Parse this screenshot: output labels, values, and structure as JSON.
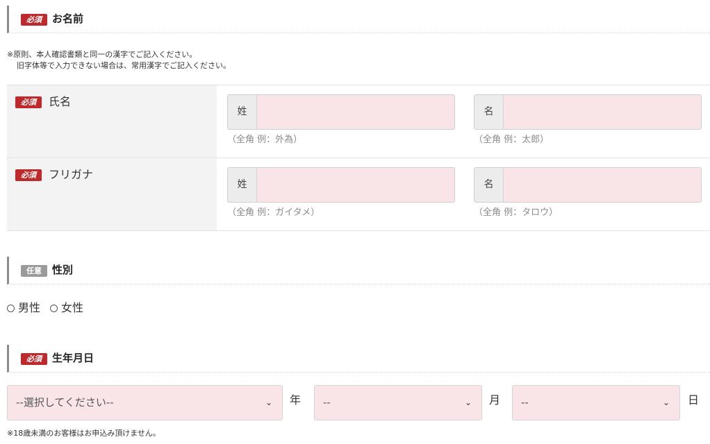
{
  "badges": {
    "required": "必須",
    "optional": "任意"
  },
  "name_section": {
    "title": "お名前",
    "note_line1": "※原則、本人確認書類と同一の漢字でご記入ください。",
    "note_line2": "旧字体等で入力できない場合は、常用漢字でご記入ください。",
    "rows": [
      {
        "label": "氏名",
        "last": {
          "prefix": "姓",
          "value": "",
          "hint": "（全角 例：外為）"
        },
        "first": {
          "prefix": "名",
          "value": "",
          "hint": "（全角 例：太郎）"
        }
      },
      {
        "label": "フリガナ",
        "last": {
          "prefix": "姓",
          "value": "",
          "hint": "（全角 例：ガイタメ）"
        },
        "first": {
          "prefix": "名",
          "value": "",
          "hint": "（全角 例：タロウ）"
        }
      }
    ]
  },
  "gender_section": {
    "title": "性別",
    "options": [
      "男性",
      "女性"
    ]
  },
  "birth_section": {
    "title": "生年月日",
    "year": {
      "value": "--選択してください--",
      "unit": "年"
    },
    "month": {
      "value": "--",
      "unit": "月"
    },
    "day": {
      "value": "--",
      "unit": "日"
    },
    "note": "※18歳未満のお客様はお申込み頂けません。"
  },
  "icons": {
    "select_arrow": "chevron-down-icon",
    "radio": "radio-circle-icon"
  },
  "colors": {
    "required_badge": "#c0292b",
    "optional_badge": "#9a9a9a",
    "input_bg": "#f9e5e8",
    "label_bg": "#f3f3f3"
  }
}
